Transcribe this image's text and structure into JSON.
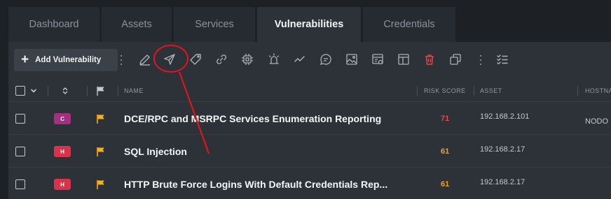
{
  "tabs": [
    {
      "label": "Dashboard",
      "active": false
    },
    {
      "label": "Assets",
      "active": false
    },
    {
      "label": "Services",
      "active": false
    },
    {
      "label": "Vulnerabilities",
      "active": true
    },
    {
      "label": "Credentials",
      "active": false
    }
  ],
  "toolbar": {
    "add_label": "Add Vulnerability",
    "icons": [
      "edit-icon",
      "send-icon",
      "tag-icon",
      "link-icon",
      "cpu-icon",
      "alarm-icon",
      "trend-icon",
      "comment-icon",
      "image-icon",
      "report-icon",
      "layout-icon",
      "delete-icon",
      "duplicate-icon",
      "checklist-icon"
    ],
    "delete_color": "#e0464e"
  },
  "table": {
    "headers": {
      "name": "NAME",
      "risk_score": "RISK SCORE",
      "asset": "ASSET",
      "hostname": "HOSTNA"
    },
    "rows": [
      {
        "severity": "C",
        "severity_color": "#a3317f",
        "name": "DCE/RPC and MSRPC Services Enumeration Reporting",
        "risk_score": "71",
        "score_color": "#e24b5b",
        "asset": "192.168.2.101",
        "hostname": "NODO"
      },
      {
        "severity": "H",
        "severity_color": "#d8334a",
        "name": "SQL Injection",
        "risk_score": "61",
        "score_color": "#f0a030",
        "asset": "192.168.2.17",
        "hostname": ""
      },
      {
        "severity": "H",
        "severity_color": "#d8334a",
        "name": "HTTP Brute Force Logins With Default Credentials Rep...",
        "risk_score": "61",
        "score_color": "#f0a030",
        "asset": "192.168.2.17",
        "hostname": ""
      }
    ]
  },
  "colors": {
    "flag": "#f5b01f",
    "annotation": "#e0141e"
  }
}
